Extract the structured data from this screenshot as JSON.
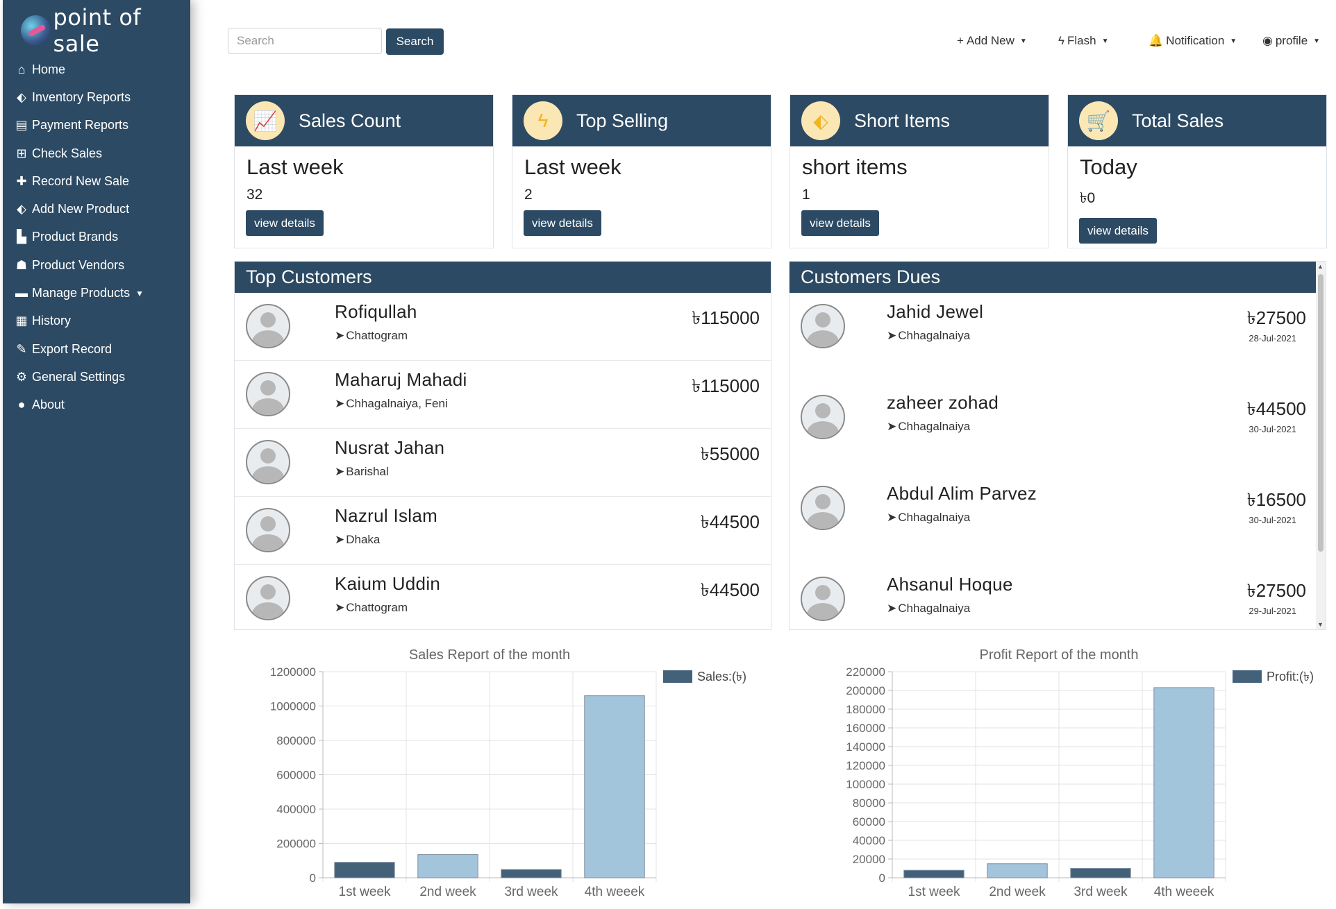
{
  "app": {
    "logo_text": "point of sale"
  },
  "sidebar": {
    "items": [
      {
        "label": "Home",
        "icon": "home-icon",
        "glyph": "⌂"
      },
      {
        "label": "Inventory Reports",
        "icon": "tags-icon",
        "glyph": "⬖"
      },
      {
        "label": "Payment Reports",
        "icon": "money-bill-icon",
        "glyph": "▤"
      },
      {
        "label": "Check Sales",
        "icon": "table-icon",
        "glyph": "⊞"
      },
      {
        "label": "Record New Sale",
        "icon": "plus-icon",
        "glyph": "✚"
      },
      {
        "label": "Add New Product",
        "icon": "tags-icon",
        "glyph": "⬖"
      },
      {
        "label": "Product Brands",
        "icon": "industry-icon",
        "glyph": "▙"
      },
      {
        "label": "Product Vendors",
        "icon": "users-icon",
        "glyph": "☗"
      },
      {
        "label": "Manage Products",
        "icon": "folder-icon",
        "glyph": "▬",
        "dropdown": true
      },
      {
        "label": "History",
        "icon": "calendar-icon",
        "glyph": "▦"
      },
      {
        "label": "Export Record",
        "icon": "edit-icon",
        "glyph": "✎"
      },
      {
        "label": "General Settings",
        "icon": "cogs-icon",
        "glyph": "⚙"
      },
      {
        "label": "About",
        "icon": "info-circle-icon",
        "glyph": "●"
      }
    ]
  },
  "topbar": {
    "search_placeholder": "Search",
    "search_button": "Search",
    "menus": [
      {
        "label": "Add New",
        "icon": "plus-icon",
        "glyph": "+"
      },
      {
        "label": "Flash",
        "icon": "bolt-icon",
        "glyph": "ϟ"
      },
      {
        "label": "Notification",
        "icon": "bell-icon",
        "glyph": "🔔"
      },
      {
        "label": "profile",
        "icon": "user-circle-icon",
        "glyph": "◉"
      }
    ]
  },
  "cards": [
    {
      "title": "Sales Count",
      "period": "Last week",
      "value": "32",
      "button": "view details",
      "icon": "chart-area-icon",
      "glyph": "📈"
    },
    {
      "title": "Top Selling",
      "period": "Last week",
      "value": "2",
      "button": "view details",
      "icon": "bolt-icon",
      "glyph": "ϟ"
    },
    {
      "title": "Short Items",
      "period": "short items",
      "value": "1",
      "button": "view details",
      "icon": "tags-icon",
      "glyph": "⬖"
    },
    {
      "title": "Total Sales",
      "period": "Today",
      "value": "৳0",
      "button": "view details",
      "icon": "cart-plus-icon",
      "glyph": "🛒"
    }
  ],
  "top_customers": {
    "title": "Top Customers",
    "rows": [
      {
        "name": "Rofiqullah",
        "location": "Chattogram",
        "amount": "৳115000"
      },
      {
        "name": "Maharuj Mahadi",
        "location": "Chhagalnaiya, Feni",
        "amount": "৳115000"
      },
      {
        "name": "Nusrat Jahan",
        "location": "Barishal",
        "amount": "৳55000"
      },
      {
        "name": "Nazrul Islam",
        "location": "Dhaka",
        "amount": "৳44500"
      },
      {
        "name": "Kaium Uddin",
        "location": "Chattogram",
        "amount": "৳44500"
      }
    ]
  },
  "customer_dues": {
    "title": "Customers Dues",
    "rows": [
      {
        "name": "Jahid Jewel",
        "location": "Chhagalnaiya",
        "amount": "৳27500",
        "date": "28-Jul-2021"
      },
      {
        "name": "zaheer zohad",
        "location": "Chhagalnaiya",
        "amount": "৳44500",
        "date": "30-Jul-2021"
      },
      {
        "name": "Abdul Alim Parvez",
        "location": "Chhagalnaiya",
        "amount": "৳16500",
        "date": "30-Jul-2021"
      },
      {
        "name": "Ahsanul Hoque",
        "location": "Chhagalnaiya",
        "amount": "৳27500",
        "date": "29-Jul-2021"
      }
    ]
  },
  "colors": {
    "primary": "#2c4a63",
    "bar_dark": "#44617a",
    "bar_light": "#a3c5dc",
    "card_icon_bg": "#fbe7b3",
    "card_icon_fg": "#f2b520"
  },
  "chart_data": [
    {
      "type": "bar",
      "title": "Sales Report of the month",
      "categories": [
        "1st week",
        "2nd week",
        "3rd week",
        "4th weeek"
      ],
      "series": [
        {
          "name": "Sales:(৳)",
          "values": [
            90000,
            135000,
            48000,
            1060000
          ]
        }
      ],
      "ylim": [
        0,
        1200000
      ],
      "yticks": [
        0,
        200000,
        400000,
        600000,
        800000,
        1000000,
        1200000
      ],
      "legend": "top-right",
      "grid": true
    },
    {
      "type": "bar",
      "title": "Profit Report of the month",
      "categories": [
        "1st week",
        "2nd week",
        "3rd week",
        "4th weeek"
      ],
      "series": [
        {
          "name": "Profit:(৳)",
          "values": [
            8000,
            15000,
            10000,
            203000
          ]
        }
      ],
      "ylim": [
        0,
        220000
      ],
      "yticks": [
        0,
        20000,
        40000,
        60000,
        80000,
        100000,
        120000,
        140000,
        160000,
        180000,
        200000,
        220000
      ],
      "legend": "top-right",
      "grid": true
    }
  ]
}
